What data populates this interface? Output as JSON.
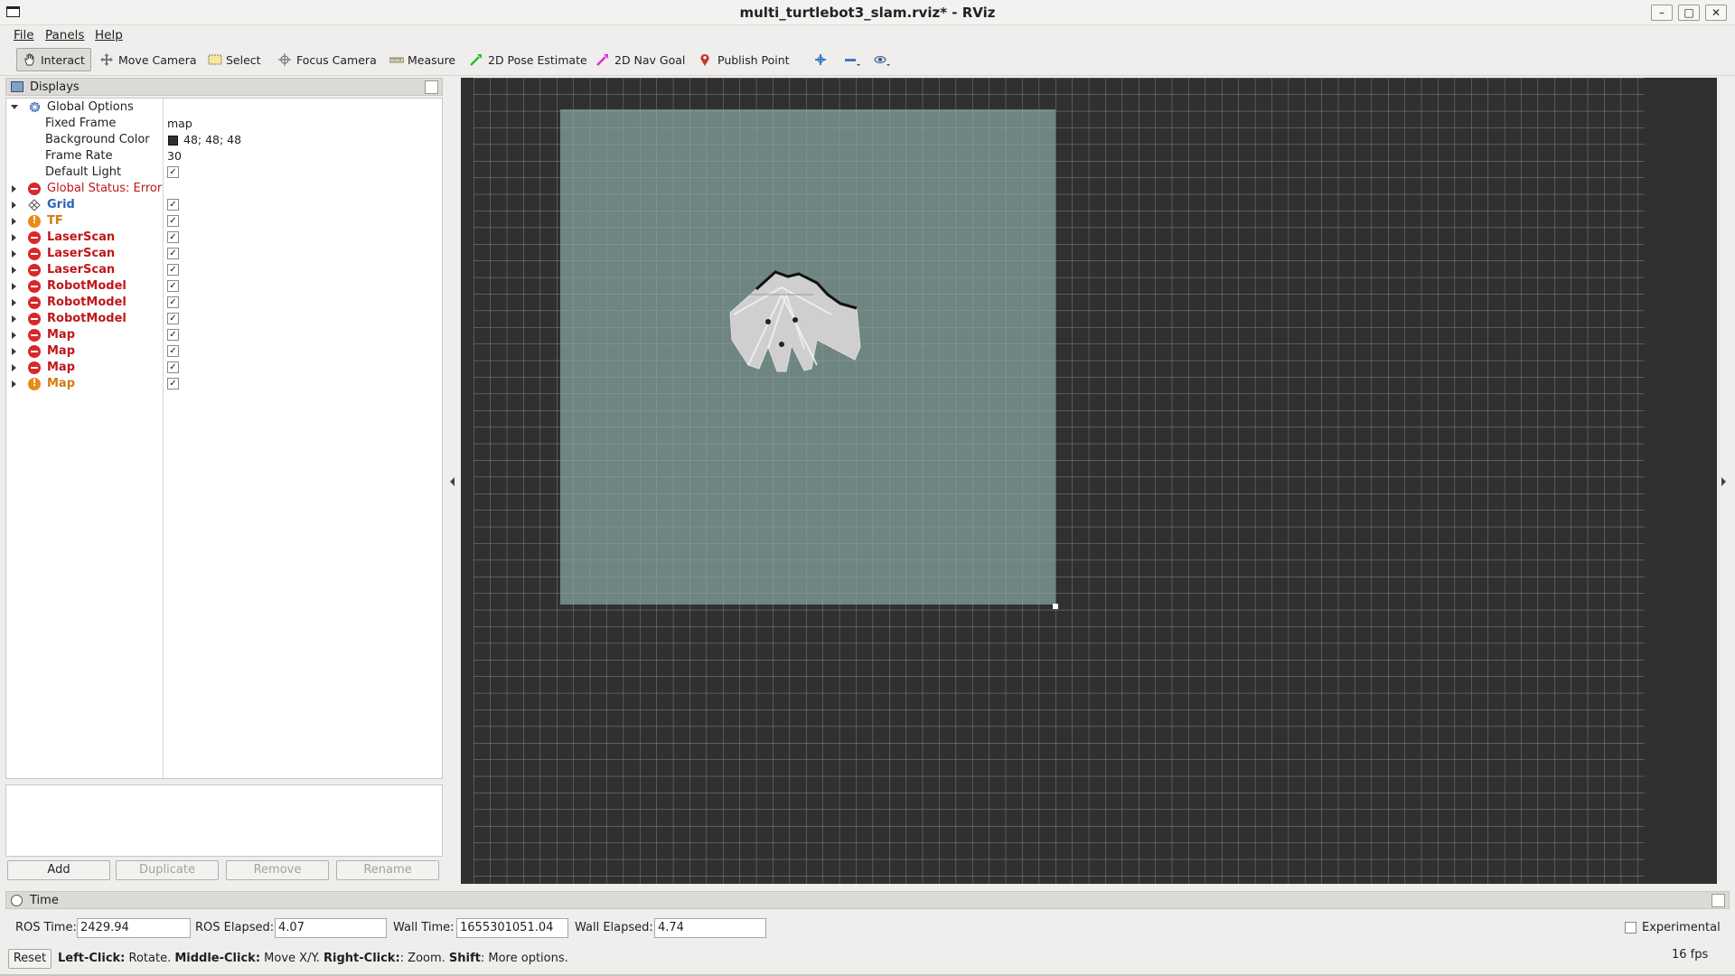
{
  "window": {
    "title": "multi_turtlebot3_slam.rviz* - RViz"
  },
  "menu": [
    {
      "label": "File"
    },
    {
      "label": "Panels"
    },
    {
      "label": "Help"
    }
  ],
  "toolbar": {
    "interact": "Interact",
    "move_camera": "Move Camera",
    "select": "Select",
    "focus_camera": "Focus Camera",
    "measure": "Measure",
    "pose_estimate": "2D Pose Estimate",
    "nav_goal": "2D Nav Goal",
    "publish_point": "Publish Point"
  },
  "displays": {
    "header": "Displays",
    "global_options": {
      "label": "Global Options",
      "properties": [
        {
          "name": "Fixed Frame",
          "value": "map"
        },
        {
          "name": "Background Color",
          "value": "48; 48; 48",
          "swatch": "#303030"
        },
        {
          "name": "Frame Rate",
          "value": "30"
        },
        {
          "name": "Default Light",
          "checked": true
        }
      ]
    },
    "global_status": {
      "label": "Global Status: Error",
      "state": "error"
    },
    "items": [
      {
        "label": "Grid",
        "state": "ok",
        "checked": true
      },
      {
        "label": "TF",
        "state": "warn",
        "checked": true
      },
      {
        "label": "LaserScan",
        "state": "error",
        "checked": true
      },
      {
        "label": "LaserScan",
        "state": "error",
        "checked": true
      },
      {
        "label": "LaserScan",
        "state": "error",
        "checked": true
      },
      {
        "label": "RobotModel",
        "state": "error",
        "checked": true
      },
      {
        "label": "RobotModel",
        "state": "error",
        "checked": true
      },
      {
        "label": "RobotModel",
        "state": "error",
        "checked": true
      },
      {
        "label": "Map",
        "state": "error",
        "checked": true
      },
      {
        "label": "Map",
        "state": "error",
        "checked": true
      },
      {
        "label": "Map",
        "state": "error",
        "checked": true
      },
      {
        "label": "Map",
        "state": "warn",
        "checked": true
      }
    ],
    "buttons": {
      "add": "Add",
      "duplicate": "Duplicate",
      "remove": "Remove",
      "rename": "Rename"
    }
  },
  "time": {
    "header": "Time",
    "ros_time_label": "ROS Time:",
    "ros_time": "2429.94",
    "ros_elapsed_label": "ROS Elapsed:",
    "ros_elapsed": "4.07",
    "wall_time_label": "Wall Time:",
    "wall_time": "1655301051.04",
    "wall_elapsed_label": "Wall Elapsed:",
    "wall_elapsed": "4.74",
    "experimental": "Experimental",
    "reset": "Reset",
    "hint": {
      "left_key": "Left-Click:",
      "left_action": " Rotate. ",
      "middle_key": "Middle-Click:",
      "middle_action": " Move X/Y. ",
      "right_key": "Right-Click:",
      "right_action": ": Zoom. ",
      "shift_key": "Shift",
      "shift_action": ": More options."
    },
    "fps": "16 fps"
  },
  "colors": {
    "background": "#303030",
    "grid": "#a0a0a0",
    "map_free": "#6e8582",
    "error": "#c0161b",
    "warn": "#d07d0e",
    "ok_link": "#2d63b8"
  }
}
